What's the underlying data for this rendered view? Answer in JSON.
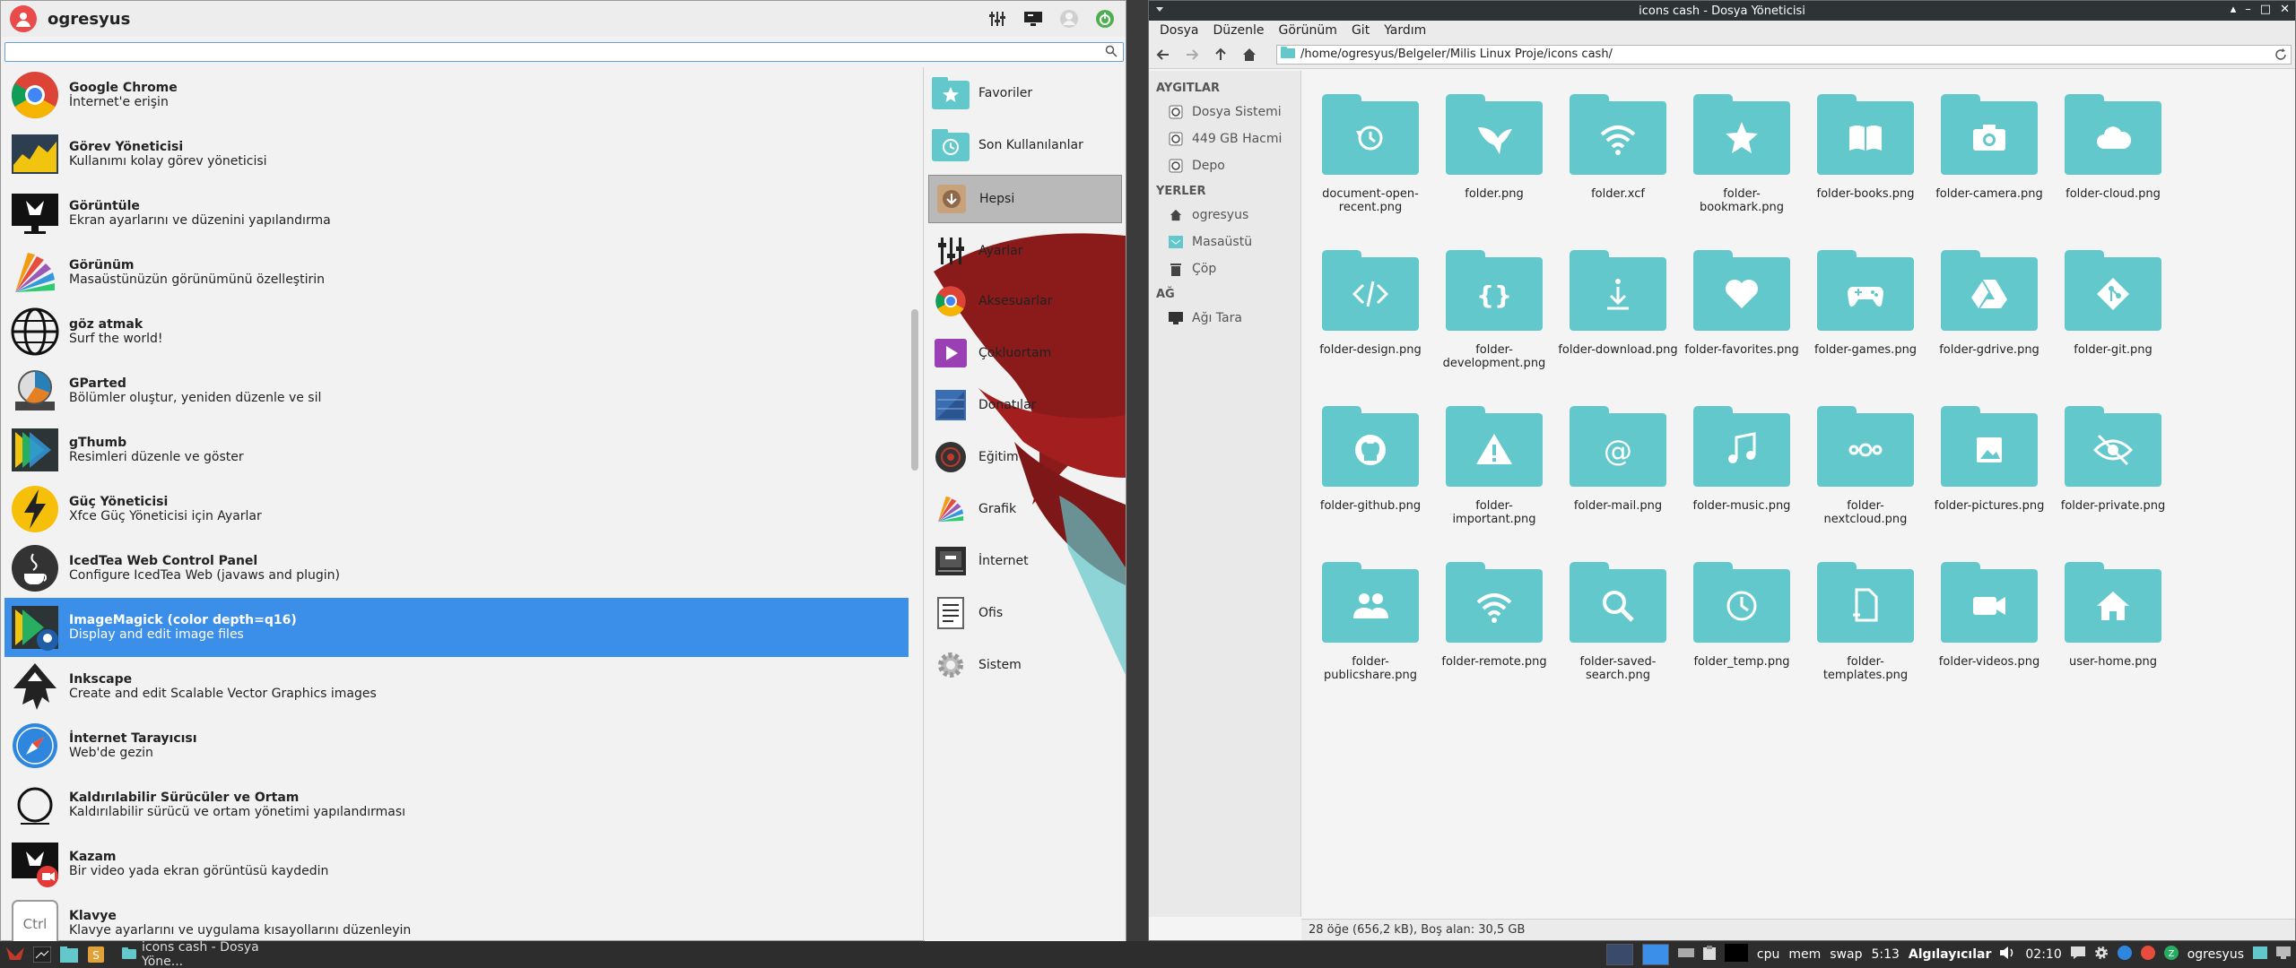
{
  "menu": {
    "username": "ogresyus",
    "search_placeholder": "",
    "apps": [
      {
        "name": "Google Chrome",
        "desc": "İnternet'e erişin",
        "icon": "chrome-icon"
      },
      {
        "name": "Görev Yöneticisi",
        "desc": "Kullanımı kolay görev yöneticisi",
        "icon": "task-manager-icon"
      },
      {
        "name": "Görüntüle",
        "desc": "Ekran ayarlarını ve düzenini yapılandırma",
        "icon": "display-settings-icon"
      },
      {
        "name": "Görünüm",
        "desc": "Masaüstünüzün görünümünü özelleştirin",
        "icon": "appearance-icon"
      },
      {
        "name": "göz atmak",
        "desc": "Surf the world!",
        "icon": "globe-icon"
      },
      {
        "name": "GParted",
        "desc": "Bölümler oluştur, yeniden düzenle ve sil",
        "icon": "gparted-icon"
      },
      {
        "name": "gThumb",
        "desc": "Resimleri düzenle ve göster",
        "icon": "gthumb-icon"
      },
      {
        "name": "Güç Yöneticisi",
        "desc": "Xfce Güç Yöneticisi için Ayarlar",
        "icon": "power-manager-icon"
      },
      {
        "name": "IcedTea Web Control Panel",
        "desc": "Configure IcedTea Web (javaws and plugin)",
        "icon": "java-icon"
      },
      {
        "name": "ImageMagick (color depth=q16)",
        "desc": "Display and edit image files",
        "icon": "imagemagick-icon"
      },
      {
        "name": "Inkscape",
        "desc": "Create and edit Scalable Vector Graphics images",
        "icon": "inkscape-icon"
      },
      {
        "name": "İnternet Tarayıcısı",
        "desc": "Web'de gezin",
        "icon": "web-browser-icon"
      },
      {
        "name": "Kaldırılabilir Sürücüler ve Ortam",
        "desc": "Kaldırılabilir sürücü ve ortam yönetimi yapılandırması",
        "icon": "removable-drives-icon"
      },
      {
        "name": "Kazam",
        "desc": "Bir video yada ekran görüntüsü kaydedin",
        "icon": "kazam-icon"
      },
      {
        "name": "Klavye",
        "desc": "Klavye ayarlarını ve uygulama kısayollarını düzenleyin",
        "icon": "keyboard-icon"
      }
    ],
    "categories": [
      {
        "label": "Favoriler",
        "icon": "star-folder-icon"
      },
      {
        "label": "Son Kullanılanlar",
        "icon": "recent-folder-icon"
      },
      {
        "label": "Hepsi",
        "icon": "all-apps-icon"
      },
      {
        "label": "Ayarlar",
        "icon": "settings-mixer-icon"
      },
      {
        "label": "Aksesuarlar",
        "icon": "chrome-icon"
      },
      {
        "label": "Çokluortam",
        "icon": "multimedia-icon"
      },
      {
        "label": "Donatılar",
        "icon": "accessories-icon"
      },
      {
        "label": "Eğitim",
        "icon": "education-icon"
      },
      {
        "label": "Grafik",
        "icon": "graphics-icon"
      },
      {
        "label": "İnternet",
        "icon": "internet-icon"
      },
      {
        "label": "Ofis",
        "icon": "office-icon"
      },
      {
        "label": "Sistem",
        "icon": "system-gear-icon"
      }
    ]
  },
  "fm": {
    "title": "icons cash - Dosya Yöneticisi",
    "menus": [
      "Dosya",
      "Düzenle",
      "Görünüm",
      "Git",
      "Yardım"
    ],
    "path": "/home/ogresyus/Belgeler/Milis Linux Proje/icons cash/",
    "sidebar": {
      "devices_header": "AYGITLAR",
      "devices": [
        "Dosya Sistemi",
        "449 GB Hacmi",
        "Depo"
      ],
      "places_header": "YERLER",
      "places": [
        "ogresyus",
        "Masaüstü",
        "Çöp"
      ],
      "network_header": "AĞ",
      "network": [
        "Ağı Tara"
      ]
    },
    "files": [
      {
        "name": "document-open-recent.png",
        "glyph": "history"
      },
      {
        "name": "folder.png",
        "glyph": "eagle"
      },
      {
        "name": "folder.xcf",
        "glyph": "wifi"
      },
      {
        "name": "folder-bookmark.png",
        "glyph": "star"
      },
      {
        "name": "folder-books.png",
        "glyph": "book"
      },
      {
        "name": "folder-camera.png",
        "glyph": "camera"
      },
      {
        "name": "folder-cloud.png",
        "glyph": "cloud"
      },
      {
        "name": "folder-design.png",
        "glyph": "code"
      },
      {
        "name": "folder-development.png",
        "glyph": "braces"
      },
      {
        "name": "folder-download.png",
        "glyph": "download"
      },
      {
        "name": "folder-favorites.png",
        "glyph": "heart"
      },
      {
        "name": "folder-games.png",
        "glyph": "gamepad"
      },
      {
        "name": "folder-gdrive.png",
        "glyph": "drive"
      },
      {
        "name": "folder-git.png",
        "glyph": "git"
      },
      {
        "name": "folder-github.png",
        "glyph": "github"
      },
      {
        "name": "folder-important.png",
        "glyph": "warning"
      },
      {
        "name": "folder-mail.png",
        "glyph": "at"
      },
      {
        "name": "folder-music.png",
        "glyph": "music"
      },
      {
        "name": "folder-nextcloud.png",
        "glyph": "nextcloud"
      },
      {
        "name": "folder-pictures.png",
        "glyph": "picture"
      },
      {
        "name": "folder-private.png",
        "glyph": "eye-off"
      },
      {
        "name": "folder-publicshare.png",
        "glyph": "people"
      },
      {
        "name": "folder-remote.png",
        "glyph": "wifi"
      },
      {
        "name": "folder-saved-search.png",
        "glyph": "search"
      },
      {
        "name": "folder_temp.png",
        "glyph": "clock"
      },
      {
        "name": "folder-templates.png",
        "glyph": "template"
      },
      {
        "name": "folder-videos.png",
        "glyph": "video"
      },
      {
        "name": "user-home.png",
        "glyph": "home"
      }
    ],
    "status": "28 öğe (656,2 kB), Boş alan: 30,5 GB"
  },
  "taskbar": {
    "task_label": "icons cash - Dosya Yöne...",
    "cpu": "cpu",
    "mem": "mem",
    "swap": "swap",
    "clock_small": "5:13",
    "sensors": "Algılayıcılar",
    "time": "02:10",
    "user": "ogresyus"
  },
  "colors": {
    "folder": "#63c8cb",
    "selection": "#3c8fe8",
    "titlebar": "#2e3436"
  }
}
